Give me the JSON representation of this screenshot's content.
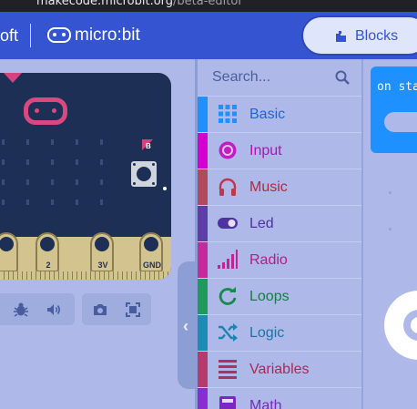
{
  "browser": {
    "url_host": "makecode.microbit.org",
    "url_path": "/beta-editor"
  },
  "header": {
    "brand_partial": "oft",
    "product": "micro:bit",
    "blocks_button": "Blocks",
    "accent": "#3454d1"
  },
  "simulator": {
    "pins": [
      "2",
      "3V",
      "GND"
    ],
    "button_b": "B",
    "controls": [
      "debug-icon",
      "sound-icon",
      "screenshot-icon",
      "fullscreen-icon"
    ]
  },
  "toolbox": {
    "search_placeholder": "Search...",
    "categories": [
      {
        "label": "Basic",
        "icon": "grid-icon",
        "color": "#1e90ff"
      },
      {
        "label": "Input",
        "icon": "input-icon",
        "color": "#d400d4"
      },
      {
        "label": "Music",
        "icon": "headphones-icon",
        "color": "#e63022"
      },
      {
        "label": "Led",
        "icon": "toggle-icon",
        "color": "#5c2d91"
      },
      {
        "label": "Radio",
        "icon": "signal-icon",
        "color": "#e3008c"
      },
      {
        "label": "Loops",
        "icon": "loop-icon",
        "color": "#00aa00"
      },
      {
        "label": "Logic",
        "icon": "shuffle-icon",
        "color": "#00a4a6"
      },
      {
        "label": "Variables",
        "icon": "list-icon",
        "color": "#dc143c"
      },
      {
        "label": "Math",
        "icon": "calculator-icon",
        "color": "#9400d3"
      }
    ]
  },
  "workspace": {
    "on_start_block": "on start"
  }
}
